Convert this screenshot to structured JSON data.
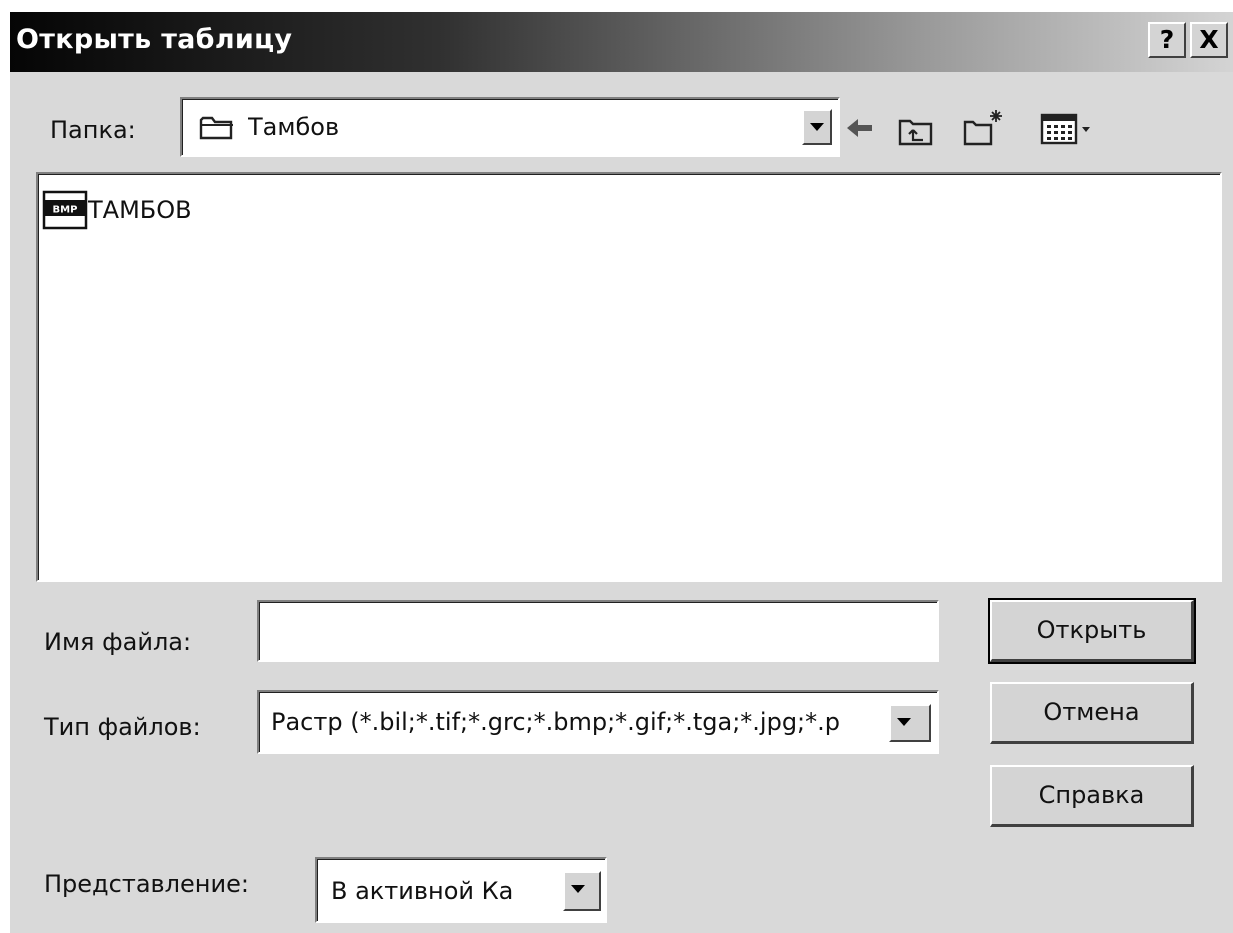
{
  "window": {
    "title": "Открыть таблицу",
    "help_label": "?",
    "close_label": "X"
  },
  "folder": {
    "label": "Папка:",
    "value": "Тамбов"
  },
  "toolbar_icons": [
    "back-arrow-icon",
    "up-folder-icon",
    "new-folder-icon",
    "view-menu-icon"
  ],
  "files": [
    {
      "name": "ТАМБОВ",
      "badge": "BMP"
    }
  ],
  "filename": {
    "label": "Имя файла:",
    "value": ""
  },
  "filetype": {
    "label": "Тип файлов:",
    "value": "Растр (*.bil;*.tif;*.grc;*.bmp;*.gif;*.tga;*.jpg;*.p"
  },
  "view": {
    "label": "Представление:",
    "value": "В активной Ка"
  },
  "buttons": {
    "open": "Открыть",
    "cancel": "Отмена",
    "help": "Справка"
  }
}
